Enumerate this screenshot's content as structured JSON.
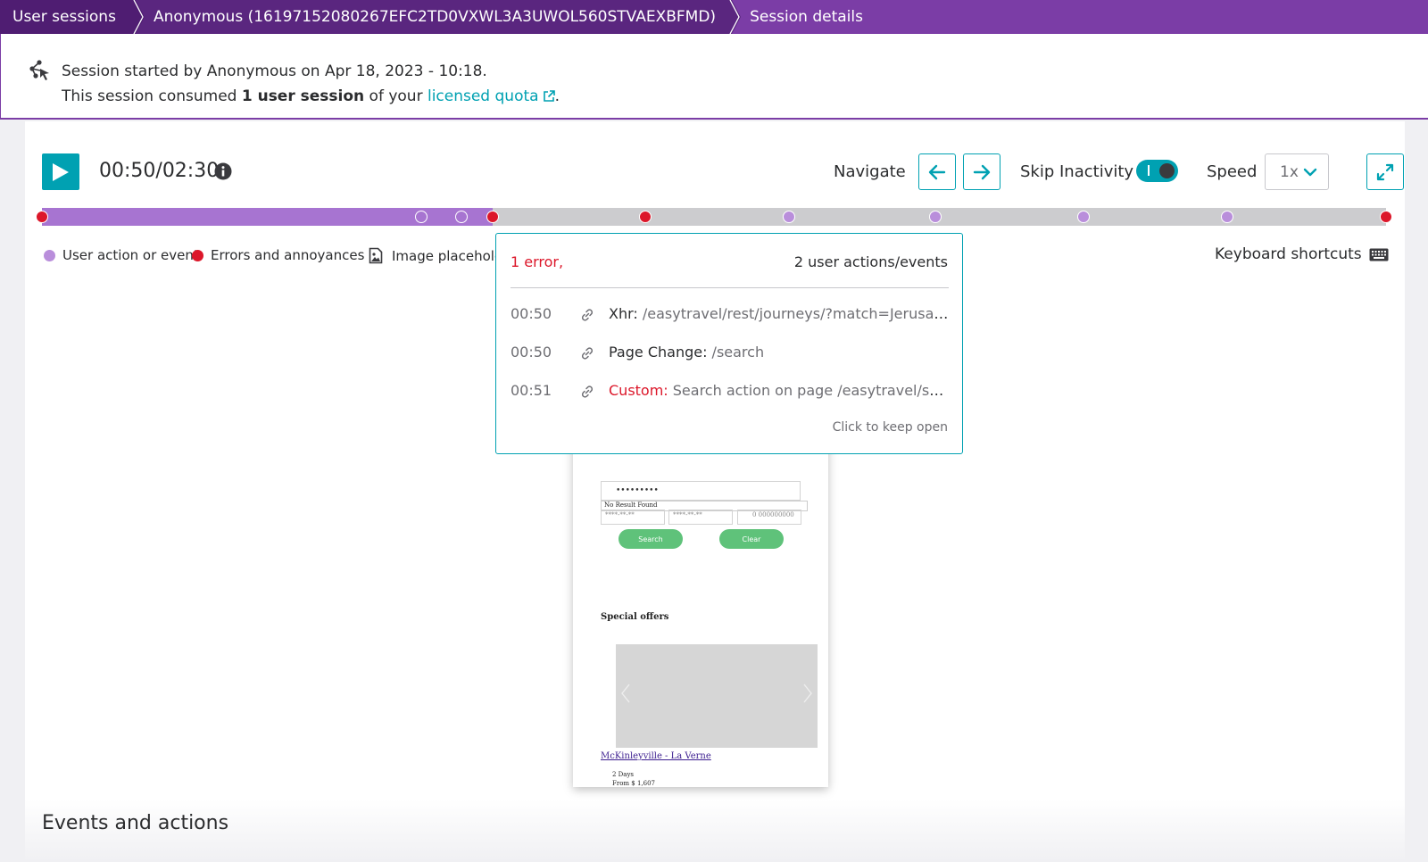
{
  "breadcrumb": {
    "items": [
      {
        "label": "User sessions"
      },
      {
        "label": "Anonymous (16197152080267EFC2TD0VXWL3A3UWOL560STVAEXBFMD)"
      },
      {
        "label": "Session details"
      }
    ]
  },
  "session": {
    "started_text": "Session started by Anonymous on Apr 18, 2023 - 10:18.",
    "consumed_prefix": "This session consumed ",
    "consumed_bold": "1 user session",
    "consumed_middle": " of your ",
    "quota_link": "licensed quota",
    "consumed_suffix": "."
  },
  "player": {
    "time": "00:50/02:30",
    "navigate_label": "Navigate",
    "skip_inactivity_label": "Skip Inactivity",
    "skip_inactivity_on": true,
    "speed_label": "Speed",
    "speed_value": "1x",
    "progress": 0.335,
    "markers": [
      {
        "type": "error",
        "pos": 0.0
      },
      {
        "type": "action",
        "pos": 0.282
      },
      {
        "type": "action",
        "pos": 0.312
      },
      {
        "type": "error",
        "pos": 0.335
      },
      {
        "type": "error",
        "pos": 0.449
      },
      {
        "type": "action",
        "pos": 0.556
      },
      {
        "type": "action",
        "pos": 0.665
      },
      {
        "type": "action",
        "pos": 0.775
      },
      {
        "type": "action",
        "pos": 0.882
      },
      {
        "type": "error",
        "pos": 1.0
      }
    ]
  },
  "legend": {
    "action_label": "User action or event",
    "error_label": "Errors and annoyances",
    "image_label": "Image placeholder",
    "keyboard_label": "Keyboard shortcuts"
  },
  "tooltip": {
    "error_summary": "1 error,",
    "actions_summary": "2 user actions/events",
    "rows": [
      {
        "time": "00:50",
        "type": "Xhr:",
        "name": " /easytravel/rest/journeys/?match=Jerusalem",
        "is_error": false
      },
      {
        "time": "00:50",
        "type": "Page Change:",
        "name": " /search",
        "is_error": false
      },
      {
        "time": "00:51",
        "type": "Custom:",
        "name": " Search action on page /easytravel/search",
        "is_error": true
      }
    ],
    "keep_open": "Click to keep open"
  },
  "replay": {
    "input_value": "•••••••••",
    "no_result": "No Result Found",
    "field_1": "****-**-**",
    "field_2": "****-**-**",
    "field_3": "0 000000000",
    "search_button": "Search",
    "clear_button": "Clear",
    "special_offers": "Special offers",
    "offer_link": "McKinleyville - La Verne",
    "offer_days": "2 Days",
    "offer_price": "From $ 1,607"
  },
  "events_title": "Events and actions",
  "colors": {
    "brand_purple": "#7b3da6",
    "accent_teal": "#00a1b2",
    "error_red": "#dc172a",
    "action_purple": "#b98edb"
  }
}
